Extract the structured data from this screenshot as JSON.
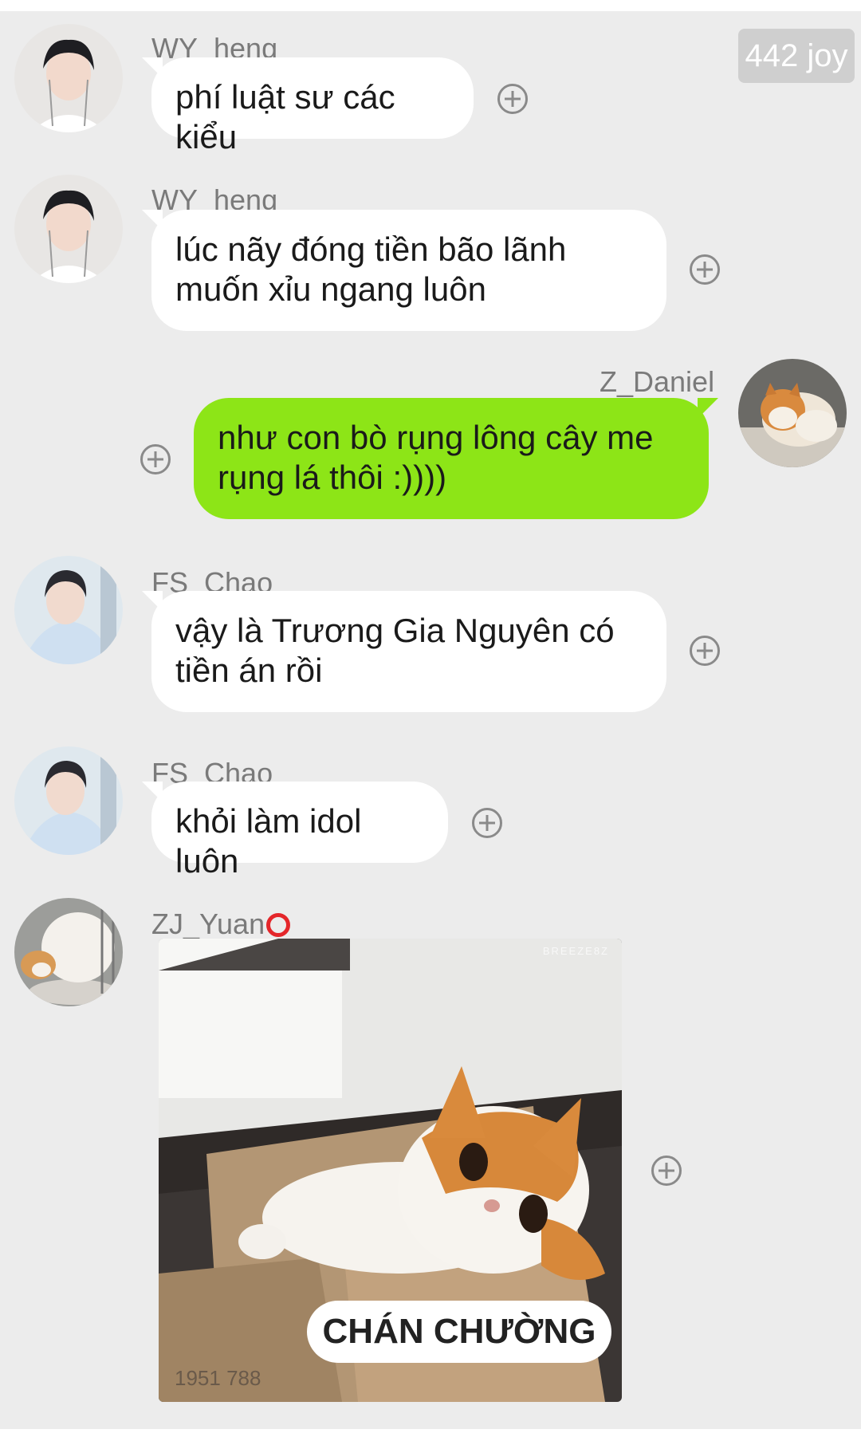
{
  "header": {
    "badge": "442 joy"
  },
  "messages": [
    {
      "sender": "WY_heng",
      "text": "phí luật sư các kiểu",
      "side": "left"
    },
    {
      "sender": "WY_heng",
      "text": "lúc nãy đóng tiền bão lãnh muốn xỉu ngang luôn",
      "side": "left"
    },
    {
      "sender": "Z_Daniel",
      "text": "như con bò rụng lông cây me rụng lá thôi :))))",
      "side": "right"
    },
    {
      "sender": "FS_Chao",
      "text": "vậy là Trương Gia Nguyên có tiền án rồi",
      "side": "left"
    },
    {
      "sender": "FS_Chao",
      "text": "khỏi làm idol luôn",
      "side": "left"
    },
    {
      "sender": "ZJ_Yuan",
      "side": "left",
      "sticker": {
        "caption": "CHÁN CHƯỜNG",
        "watermark": "BREEZE8Z"
      }
    }
  ],
  "colors": {
    "background": "#ececec",
    "incoming_bubble": "#ffffff",
    "outgoing_bubble": "#8de517",
    "name": "#7a7a7a",
    "badge": "#cfcfcf"
  },
  "icons": {
    "add": "plus-circle-icon",
    "status": "red-ring-icon"
  }
}
